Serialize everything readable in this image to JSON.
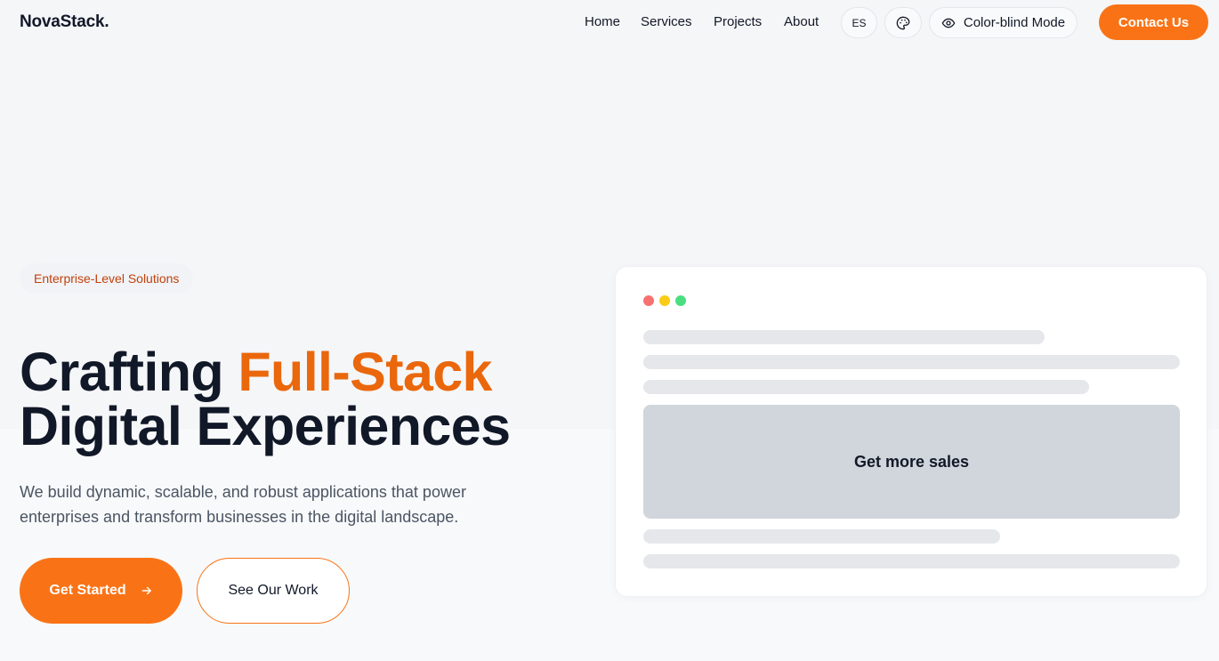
{
  "header": {
    "logo": "NovaStack.",
    "nav": [
      {
        "label": "Home"
      },
      {
        "label": "Services"
      },
      {
        "label": "Projects"
      },
      {
        "label": "About"
      }
    ],
    "language_label": "ES",
    "palette_icon": "palette-icon",
    "color_blind_icon": "eye-icon",
    "color_blind_label": "Color-blind Mode",
    "contact_label": "Contact Us"
  },
  "hero": {
    "badge": "Enterprise-Level Solutions",
    "title_part1": "Crafting ",
    "title_accent": "Full-Stack",
    "title_line2": "Digital Experiences",
    "description": "We build dynamic, scalable, and robust applications that power enterprises and transform businesses in the digital landscape.",
    "primary_cta": "Get Started",
    "primary_cta_icon": "arrow-right-icon",
    "secondary_cta": "See Our Work"
  },
  "mockup": {
    "window_dots": [
      {
        "name": "red-dot",
        "color": "#f87171"
      },
      {
        "name": "yellow-dot",
        "color": "#facc15"
      },
      {
        "name": "green-dot",
        "color": "#4ade80"
      }
    ],
    "banner_text": "Get more sales"
  },
  "colors": {
    "accent": "#f97316",
    "accent_text": "#ea670c",
    "heading": "#111827",
    "body_text": "#4b5563",
    "placeholder_bar": "#e5e7eb",
    "banner_bg": "#d1d5dc"
  }
}
